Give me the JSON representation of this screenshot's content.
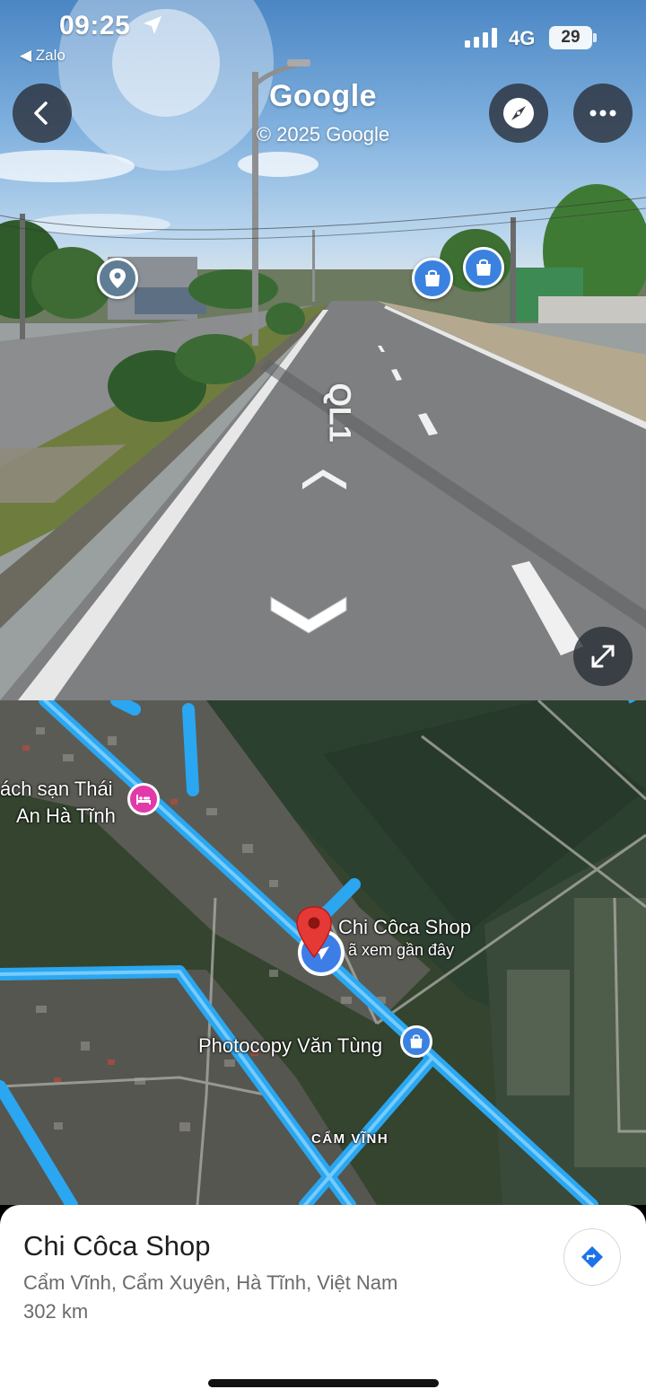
{
  "status_bar": {
    "time": "09:25",
    "back_app": "◀ Zalo",
    "network": "4G",
    "battery": "29"
  },
  "street_view": {
    "logo": "Google",
    "copyright": "© 2025 Google",
    "road_label": "QL1",
    "icons": {
      "back": "back-arrow-icon",
      "compass": "compass-icon",
      "more": "more-icon",
      "expand": "expand-icon"
    }
  },
  "map": {
    "hotel_label_line1": "ách sạn Thái",
    "hotel_label_line2": "An Hà Tĩnh",
    "shop_label": "Chi Côca Shop",
    "recent_label": "ã xem gần đây",
    "photocopy_label": "Photocopy Văn Tùng",
    "area_label": "CẨM VĨNH"
  },
  "place": {
    "name": "Chi Côca Shop",
    "address": "Cẩm Vĩnh, Cẩm Xuyên, Hà Tĩnh, Việt Nam",
    "distance": "302 km"
  },
  "colors": {
    "accent_blue": "#3d7ee6",
    "road_highlight": "#2aa7f0",
    "hotel_pink": "#e23aa9",
    "pin_red": "#e53935"
  }
}
